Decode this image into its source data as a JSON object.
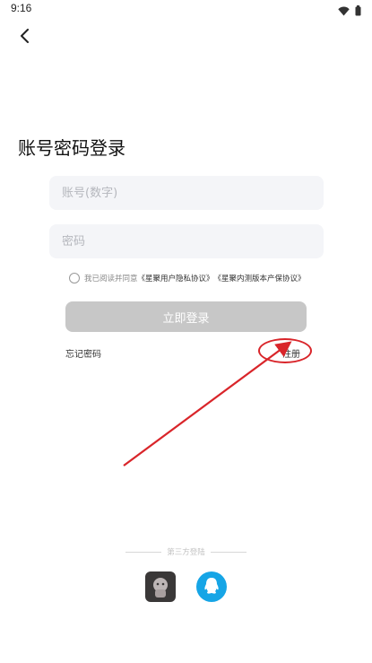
{
  "status_bar": {
    "time": "9:16",
    "icons": [
      "wifi-icon",
      "battery-icon"
    ]
  },
  "header": {
    "back_icon": "chevron-left-icon"
  },
  "login": {
    "title": "账号密码登录",
    "account_placeholder": "账号(数字)",
    "account_value": "",
    "password_placeholder": "密码",
    "password_value": "",
    "agree_prefix": "我已阅读并同意",
    "privacy_link": "《星聚用户隐私协议》",
    "copyright_link": "《星聚内测版本产保协议》",
    "agree_checked": false,
    "login_button": "立即登录",
    "forgot_password": "忘记密码",
    "register": "注册"
  },
  "third_party": {
    "label": "第三方登陆",
    "providers": [
      "app-login-icon",
      "qq-icon"
    ]
  },
  "colors": {
    "button_disabled": "#c7c7c7",
    "field_bg": "#f4f5f8",
    "annotation_red": "#d9252a",
    "qq_blue": "#16a5e6"
  }
}
